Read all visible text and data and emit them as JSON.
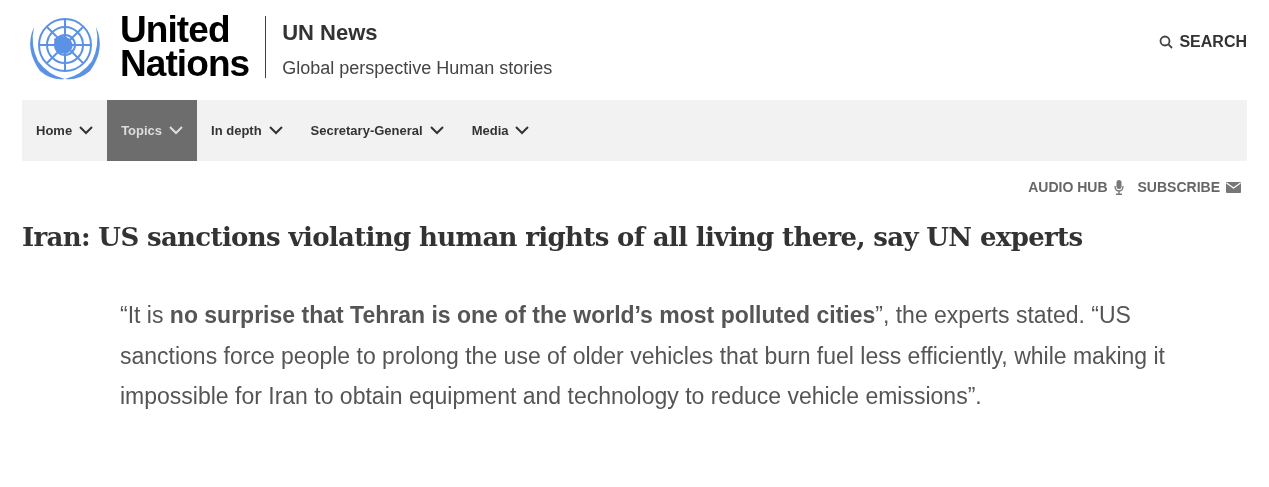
{
  "brand": {
    "line_1": "United",
    "line_2": "Nations"
  },
  "site": {
    "title": "UN News",
    "tagline": "Global perspective Human stories"
  },
  "search": {
    "label": "SEARCH"
  },
  "nav": [
    {
      "label": "Home",
      "selected": false
    },
    {
      "label": "Topics",
      "selected": true
    },
    {
      "label": "In depth",
      "selected": false
    },
    {
      "label": "Secretary-General",
      "selected": false
    },
    {
      "label": "Media",
      "selected": false
    }
  ],
  "utility_links": [
    {
      "label": "AUDIO HUB",
      "kind": "audio"
    },
    {
      "label": "SUBSCRIBE",
      "kind": "mail"
    }
  ],
  "article": {
    "title": "Iran: US sanctions violating human rights of all living there, say UN experts",
    "quote": "“It is **no surprise that Tehran is one of the world’s most polluted cities**”, the experts stated. “US sanctions force people to prolong the use of older vehicles that burn fuel less efficiently, while making it impossible for Iran to obtain equipment and technology to reduce vehicle emissions”."
  }
}
